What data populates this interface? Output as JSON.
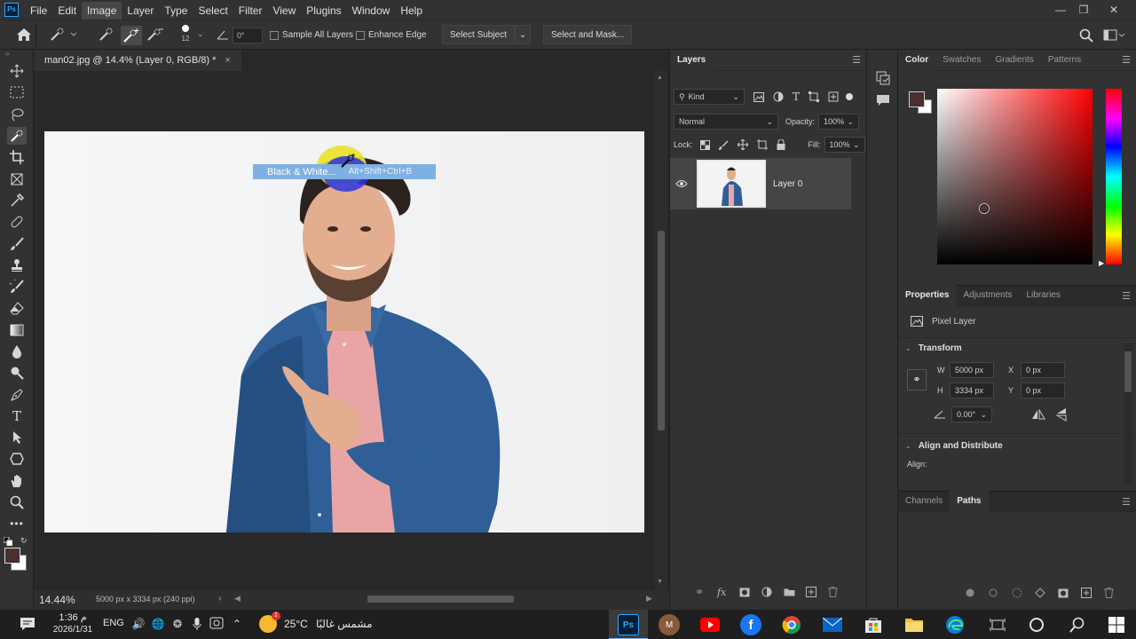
{
  "app": {
    "logo": "Ps",
    "menu": [
      "File",
      "Edit",
      "Image",
      "Layer",
      "Type",
      "Select",
      "Filter",
      "View",
      "Plugins",
      "Window",
      "Help"
    ],
    "active_menu_index": 2
  },
  "options_bar": {
    "brush_size": "12",
    "angle": "0°",
    "sample_all_layers": "Sample All Layers",
    "enhance_edge": "Enhance Edge",
    "select_subject": "Select Subject",
    "select_and_mask": "Select and Mask..."
  },
  "document": {
    "tab_title": "man02.jpg @ 14.4% (Layer 0, RGB/8) *",
    "close_symbol": "×",
    "zoom": "14.44%",
    "dimensions": "5000 px x 3334 px (240 ppi)"
  },
  "tooltip": {
    "label": "Black & White...",
    "shortcut": "Alt+Shift+Ctrl+B"
  },
  "layers_panel": {
    "tab": "Layers",
    "filter_kind": "Kind",
    "blend_mode": "Normal",
    "opacity_label": "Opacity:",
    "opacity_value": "100%",
    "lock_label": "Lock:",
    "fill_label": "Fill:",
    "fill_value": "100%",
    "layers": [
      {
        "name": "Layer 0",
        "visible": true
      }
    ]
  },
  "color_panel": {
    "tabs": [
      "Color",
      "Swatches",
      "Gradients",
      "Patterns"
    ],
    "active_tab": 0,
    "foreground_color": "#4a2f2f",
    "background_color": "#ffffff",
    "hue_color": "#ff0000"
  },
  "properties_panel": {
    "tabs": [
      "Properties",
      "Adjustments",
      "Libraries"
    ],
    "active_tab": 0,
    "kind": "Pixel Layer",
    "transform_title": "Transform",
    "w_label": "W",
    "w_value": "5000 px",
    "h_label": "H",
    "h_value": "3334 px",
    "x_label": "X",
    "x_value": "0 px",
    "y_label": "Y",
    "y_value": "0 px",
    "angle_value": "0.00°",
    "align_title": "Align and Distribute",
    "align_label": "Align:"
  },
  "bottom_tabs": {
    "tabs": [
      "Channels",
      "Paths"
    ],
    "active_tab": 1
  },
  "taskbar": {
    "time": "1:36 م",
    "date": "2026/1/31",
    "lang": "ENG",
    "temp": "25°C",
    "weather": "مشمس غالبًا",
    "weather_badge": "1",
    "apps": [
      "photoshop",
      "avatar",
      "youtube",
      "facebook",
      "chrome",
      "mail",
      "store",
      "explorer",
      "edge",
      "task-view",
      "cortana",
      "search",
      "start"
    ]
  }
}
